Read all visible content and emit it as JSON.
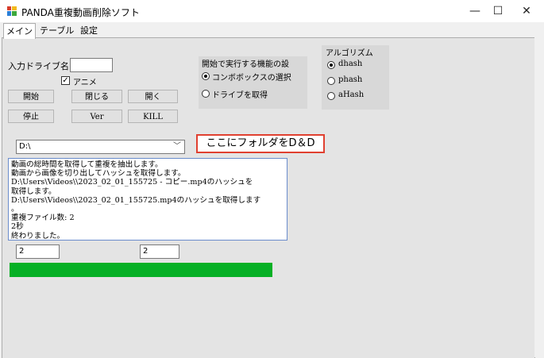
{
  "window": {
    "title": "PANDA重複動画削除ソフト",
    "minimize": "—",
    "maximize": "☐",
    "close": "✕"
  },
  "tabs": [
    {
      "label": "メイン",
      "active": true
    },
    {
      "label": "テーブル",
      "active": false
    },
    {
      "label": "設定",
      "active": false
    }
  ],
  "drive": {
    "label": "入力ドライブ名:",
    "value": ""
  },
  "anime": {
    "label": "アニメ",
    "checked": true
  },
  "buttons": {
    "start": "開始",
    "close": "閉じる",
    "open": "開く",
    "stop": "停止",
    "ver": "Ver",
    "kill": "KILL"
  },
  "startup_group": {
    "title": "開始で実行する機能の設",
    "options": [
      {
        "label": "コンボボックスの選択",
        "selected": true
      },
      {
        "label": "ドライブを取得",
        "selected": false
      }
    ]
  },
  "algorithm_group": {
    "title": "アルゴリズム",
    "options": [
      {
        "label": "dhash",
        "selected": true
      },
      {
        "label": "phash",
        "selected": false
      },
      {
        "label": "aHash",
        "selected": false
      }
    ]
  },
  "folder_combo": {
    "value": "D:\\"
  },
  "drop_hint": "ここにフォルダをD＆D",
  "log": {
    "text": "動画の総時間を取得して重複を抽出します。\n動画から画像を切り出してハッシュを取得します。\nD:\\Users\\Videos\\\\2023_02_01_155725 - コピー.mp4のハッシュを\n取得します。\nD:\\Users\\Videos\\\\2023_02_01_155725.mp4のハッシュを取得します\n。\n重複ファイル数: 2\n2秒\n終わりました。"
  },
  "field_left": {
    "value": "2"
  },
  "field_right": {
    "value": "2"
  },
  "progress": {
    "fraction": 1.0,
    "color": "#06b025"
  }
}
